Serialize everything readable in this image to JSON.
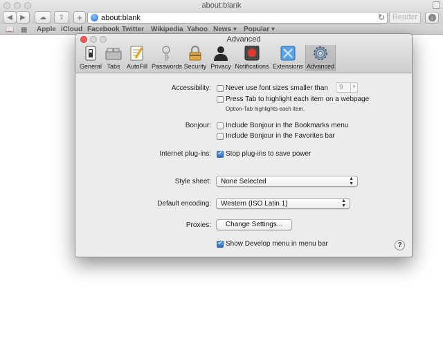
{
  "browser": {
    "title": "about:blank",
    "address": "about:blank",
    "reader_label": "Reader",
    "bookmarks": [
      "Apple",
      "iCloud",
      "Facebook",
      "Twitter",
      "Wikipedia",
      "Yahoo",
      "News ▾",
      "Popular ▾"
    ]
  },
  "prefs": {
    "title": "Advanced",
    "tabs": [
      {
        "label": "General",
        "icon": "general-switch-icon"
      },
      {
        "label": "Tabs",
        "icon": "tabs-icon"
      },
      {
        "label": "AutoFill",
        "icon": "autofill-icon"
      },
      {
        "label": "Passwords",
        "icon": "key-icon"
      },
      {
        "label": "Security",
        "icon": "lock-icon"
      },
      {
        "label": "Privacy",
        "icon": "person-icon"
      },
      {
        "label": "Notifications",
        "icon": "notification-icon"
      },
      {
        "label": "Extensions",
        "icon": "puzzle-icon"
      },
      {
        "label": "Advanced",
        "icon": "gear-icon"
      }
    ],
    "active_tab": "Advanced",
    "accessibility": {
      "label": "Accessibility:",
      "min_font_label": "Never use font sizes smaller than",
      "min_font_value": "9",
      "min_font_checked": false,
      "tab_highlight_label": "Press Tab to highlight each item on a webpage",
      "tab_highlight_checked": false,
      "hint": "Option-Tab highlights each item."
    },
    "bonjour": {
      "label": "Bonjour:",
      "bookmarks_menu_label": "Include Bonjour in the Bookmarks menu",
      "bookmarks_menu_checked": false,
      "favorites_bar_label": "Include Bonjour in the Favorites bar",
      "favorites_bar_checked": false
    },
    "plugins": {
      "label": "Internet plug-ins:",
      "stop_plugins_label": "Stop plug-ins to save power",
      "stop_plugins_checked": true
    },
    "stylesheet": {
      "label": "Style sheet:",
      "value": "None Selected"
    },
    "encoding": {
      "label": "Default encoding:",
      "value": "Western (ISO Latin 1)"
    },
    "proxies": {
      "label": "Proxies:",
      "button_label": "Change Settings..."
    },
    "develop": {
      "label": "Show Develop menu in menu bar",
      "checked": true
    },
    "help_label": "?"
  },
  "colors": {
    "accent": "#2f6fc5",
    "close_red": "#ee5c55",
    "window_bg": "#ececec"
  }
}
